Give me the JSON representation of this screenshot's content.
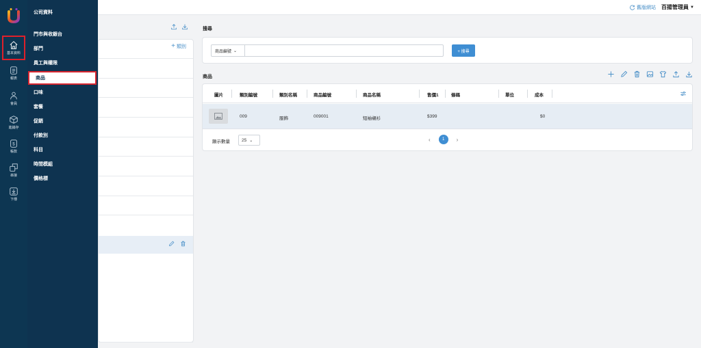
{
  "topbar": {
    "old_site_label": "舊版網站",
    "user_label": "百揚管理員"
  },
  "rail": {
    "items": [
      {
        "label": "基本資料",
        "icon": "home-icon"
      },
      {
        "label": "報表",
        "icon": "report-icon"
      },
      {
        "label": "會員",
        "icon": "member-icon"
      },
      {
        "label": "進銷存",
        "icon": "inventory-icon"
      },
      {
        "label": "帳款",
        "icon": "payment-icon"
      },
      {
        "label": "串接",
        "icon": "integration-icon"
      },
      {
        "label": "下傳",
        "icon": "download-icon"
      }
    ]
  },
  "submenu": {
    "items": [
      "公司資料",
      "門市與收銀台",
      "部門",
      "員工與權限",
      "商品",
      "口味",
      "套餐",
      "促銷",
      "付款別",
      "科目",
      "時間模組",
      "價格標"
    ],
    "active": "商品"
  },
  "left_panel": {
    "add_category_label": "類別"
  },
  "search": {
    "title": "搜尋",
    "field_select": "商品編號",
    "input_value": "",
    "button_label": "+ 搜尋"
  },
  "products": {
    "title": "商品",
    "columns": [
      "圖片",
      "類別編號",
      "類別名稱",
      "商品編號",
      "商品名稱",
      "售價1",
      "條碼",
      "單位",
      "成本"
    ],
    "rows": [
      {
        "category_no": "009",
        "category_name": "服飾",
        "product_no": "009001",
        "product_name": "短袖襯衫",
        "price1": "$399",
        "barcode": "",
        "unit": "",
        "cost": "$0"
      }
    ],
    "page_size_label": "顯示數量",
    "page_size": "25",
    "current_page": "1"
  },
  "colors": {
    "rail_bg": "#0d3652",
    "accent": "#3f8ed3",
    "highlight": "#e0202a",
    "selected_row": "#e6edf4"
  }
}
